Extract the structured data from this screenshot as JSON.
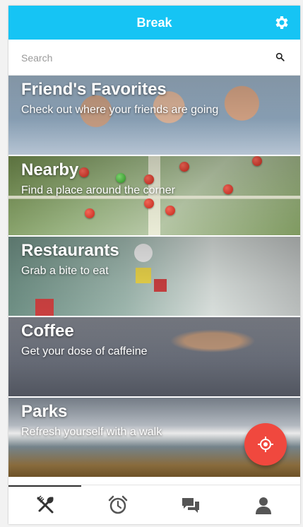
{
  "app": {
    "title": "Break"
  },
  "search": {
    "placeholder": "Search"
  },
  "cards": [
    {
      "title": "Friend's Favorites",
      "subtitle": "Check out where your friends are going"
    },
    {
      "title": "Nearby",
      "subtitle": "Find a place around the corner"
    },
    {
      "title": "Restaurants",
      "subtitle": "Grab a bite to eat"
    },
    {
      "title": "Coffee",
      "subtitle": "Get your dose of caffeine"
    },
    {
      "title": "Parks",
      "subtitle": "Refresh yourself with a walk"
    }
  ],
  "tabs": [
    {
      "icon": "fork-spoon-icon",
      "active": true
    },
    {
      "icon": "alarm-clock-icon",
      "active": false
    },
    {
      "icon": "chat-bubbles-icon",
      "active": false
    },
    {
      "icon": "person-icon",
      "active": false
    }
  ],
  "colors": {
    "appbar": "#16c4f4",
    "fab": "#f0483e",
    "icon": "#333333"
  }
}
